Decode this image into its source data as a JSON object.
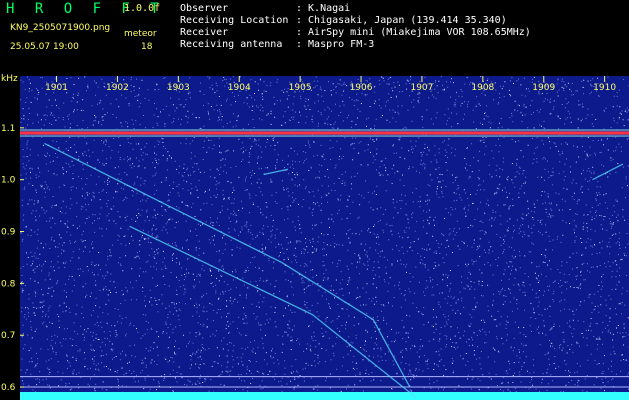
{
  "header": {
    "app_title": "H R O F F T",
    "version": "1.0.0f",
    "filename": "KN9_2505071900.png",
    "datetime": "25.05.07 19:00",
    "meteor_label": "meteor",
    "meteor_count": "18",
    "info": [
      {
        "key": "Observer",
        "value": ": K.Nagai"
      },
      {
        "key": "Receiving Location",
        "value": ": Chigasaki, Japan (139.414 35.340)"
      },
      {
        "key": "Receiver",
        "value": ": AirSpy mini (Miakejima VOR 108.65MHz)"
      },
      {
        "key": "Receiving antenna",
        "value": ": Maspro FM-3"
      }
    ]
  },
  "colors": {
    "background": "#0d1a8c",
    "signal": "#ff3344",
    "text": "#ffff66",
    "title": "#00ff66",
    "baseline": "#33ffff"
  },
  "chart_data": {
    "type": "heatmap",
    "ylabel": "kHz",
    "x_ticks": [
      "1901",
      "1902",
      "1903",
      "1904",
      "1905",
      "1906",
      "1907",
      "1908",
      "1909",
      "1910"
    ],
    "y_ticks": [
      "1.1",
      "1.0",
      "0.9",
      "0.8",
      "0.7",
      "0.6"
    ],
    "ylim": [
      0.575,
      1.2
    ],
    "xlim": [
      1900.4,
      1910.4
    ],
    "carrier_khz": 1.09,
    "reference_lines_khz": [
      0.62,
      0.6
    ],
    "meteor_traces": [
      {
        "x": [
          1900.8,
          1903.0,
          1904.7,
          1906.2,
          1906.8
        ],
        "y": [
          1.07,
          0.94,
          0.84,
          0.73,
          0.6
        ]
      },
      {
        "x": [
          1902.2,
          1905.2,
          1906.9
        ],
        "y": [
          0.91,
          0.74,
          0.58
        ]
      },
      {
        "x": [
          1904.4,
          1904.8
        ],
        "y": [
          1.01,
          1.02
        ]
      },
      {
        "x": [
          1909.8,
          1910.3
        ],
        "y": [
          1.0,
          1.03
        ]
      }
    ]
  }
}
